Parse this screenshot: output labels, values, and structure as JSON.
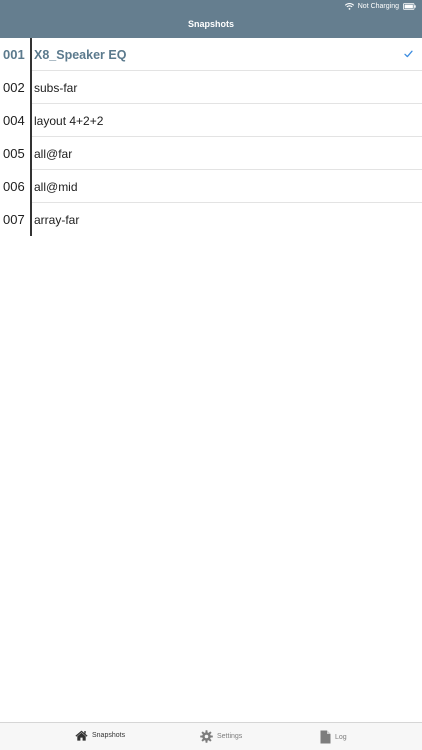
{
  "status": {
    "battery_text": "Not Charging",
    "wifi_icon": "wifi-icon",
    "battery_icon": "battery-icon"
  },
  "nav": {
    "title": "Snapshots"
  },
  "snapshots": [
    {
      "number": "001",
      "name": "X8_Speaker EQ",
      "selected": true
    },
    {
      "number": "002",
      "name": "subs-far",
      "selected": false
    },
    {
      "number": "004",
      "name": "layout 4+2+2",
      "selected": false
    },
    {
      "number": "005",
      "name": "all@far",
      "selected": false
    },
    {
      "number": "006",
      "name": "all@mid",
      "selected": false
    },
    {
      "number": "007",
      "name": "array-far",
      "selected": false
    }
  ],
  "tabs": [
    {
      "label": "Snapshots",
      "icon": "home-icon",
      "active": true
    },
    {
      "label": "Settings",
      "icon": "gear-icon",
      "active": false
    },
    {
      "label": "Log",
      "icon": "document-icon",
      "active": false
    }
  ],
  "colors": {
    "header": "#657e8f",
    "selected_text": "#5b7a8d",
    "checkmark": "#3d8de0"
  }
}
